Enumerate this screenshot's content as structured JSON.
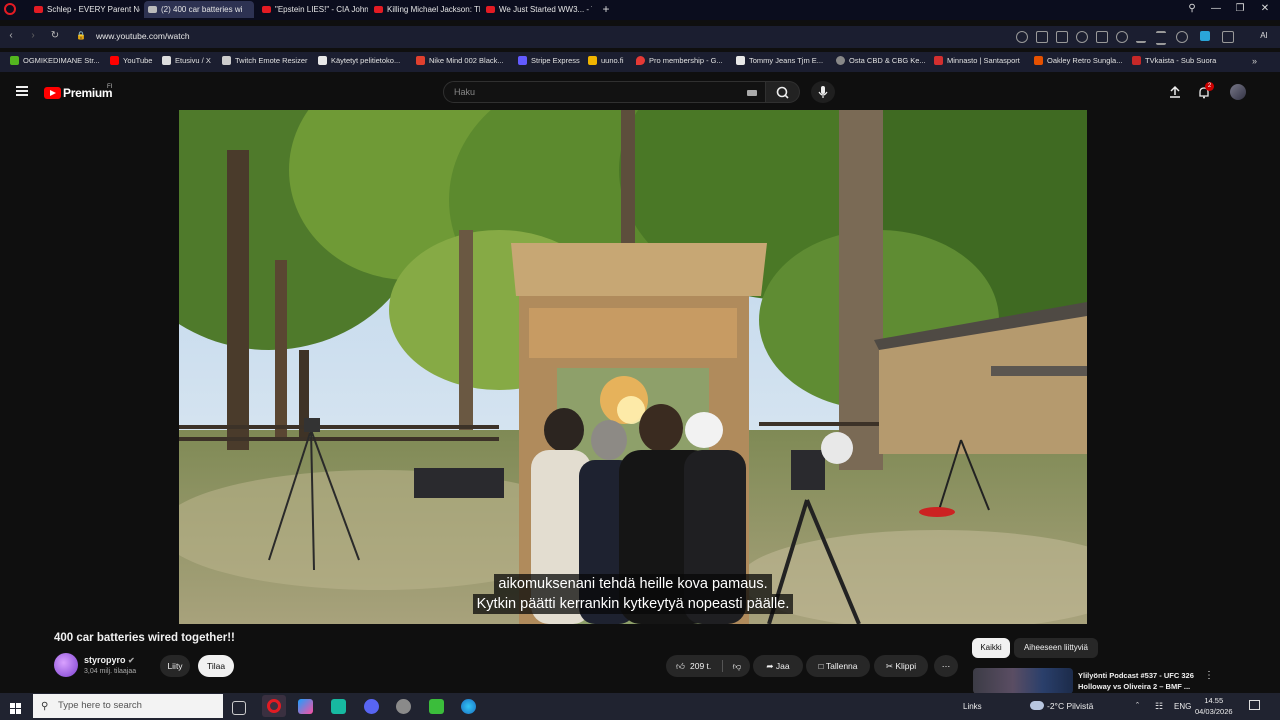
{
  "browser": {
    "tabs": [
      {
        "label": "Schlep - EVERY Parent Ne",
        "active": false
      },
      {
        "label": "(2) 400 car batteries wi",
        "active": true
      },
      {
        "label": "\"Epstein LIES!\" - CIA John",
        "active": false
      },
      {
        "label": "Killing Michael Jackson: Th",
        "active": false
      },
      {
        "label": "We Just Started WW3... - Y",
        "active": false
      }
    ],
    "url": "www.youtube.com/watch",
    "ai_label": "AI",
    "bookmarks": [
      {
        "label": "OGMIKEDIMANE Str...",
        "color": "#53b51f"
      },
      {
        "label": "YouTube",
        "color": "#ff0000"
      },
      {
        "label": "Etusivu / X",
        "color": "#dddddd"
      },
      {
        "label": "Twitch Emote Resizer",
        "color": "#cccccc"
      },
      {
        "label": "Käytetyt pelitietoko...",
        "color": "#e8e8e8"
      },
      {
        "label": "Nike Mind 002 Black...",
        "color": "#e0402e"
      },
      {
        "label": "Stripe Express",
        "color": "#635bff"
      },
      {
        "label": "uuno.fi",
        "color": "#f0b400"
      },
      {
        "label": "Pro membership - G...",
        "color": "#e53935"
      },
      {
        "label": "Tommy Jeans Tjm E...",
        "color": "#e8e8e8"
      },
      {
        "label": "Osta CBD & CBG Ke...",
        "color": "#888888"
      },
      {
        "label": "Minnasto | Santasport",
        "color": "#d32f2f"
      },
      {
        "label": "Oakley Retro Sungla...",
        "color": "#e65100"
      },
      {
        "label": "TVkaista - Sub Suora",
        "color": "#c62828"
      }
    ]
  },
  "youtube": {
    "brand": "Premium",
    "brand_region": "FI",
    "search_placeholder": "Haku",
    "notification_count": "2",
    "subtitle_line1": "aikomuksenani tehdä heille kova pamaus.",
    "subtitle_line2": "Kytkin päätti kerrankin kytkeytyä nopeasti päälle.",
    "video_title": "400 car batteries wired together!!",
    "channel_name": "styropyro",
    "channel_subs": "3,04 milj. tilaajaa",
    "join_label": "Liity",
    "subscribe_label": "Tilaa",
    "like_count": "209 t.",
    "share_label": "Jaa",
    "save_label": "Tallenna",
    "clip_label": "Klippi",
    "chips": [
      "Kaikki",
      "Aiheeseen liittyviä"
    ],
    "recommended_title": "Ylilyönti Podcast #537 - UFC 326 Holloway vs Oliveira 2 – BMF ..."
  },
  "taskbar": {
    "search_placeholder": "Type here to search",
    "links_label": "Links",
    "weather": "-2°C  Pilvistä",
    "language": "ENG",
    "time": "14.55",
    "date": "04/03/2026"
  }
}
